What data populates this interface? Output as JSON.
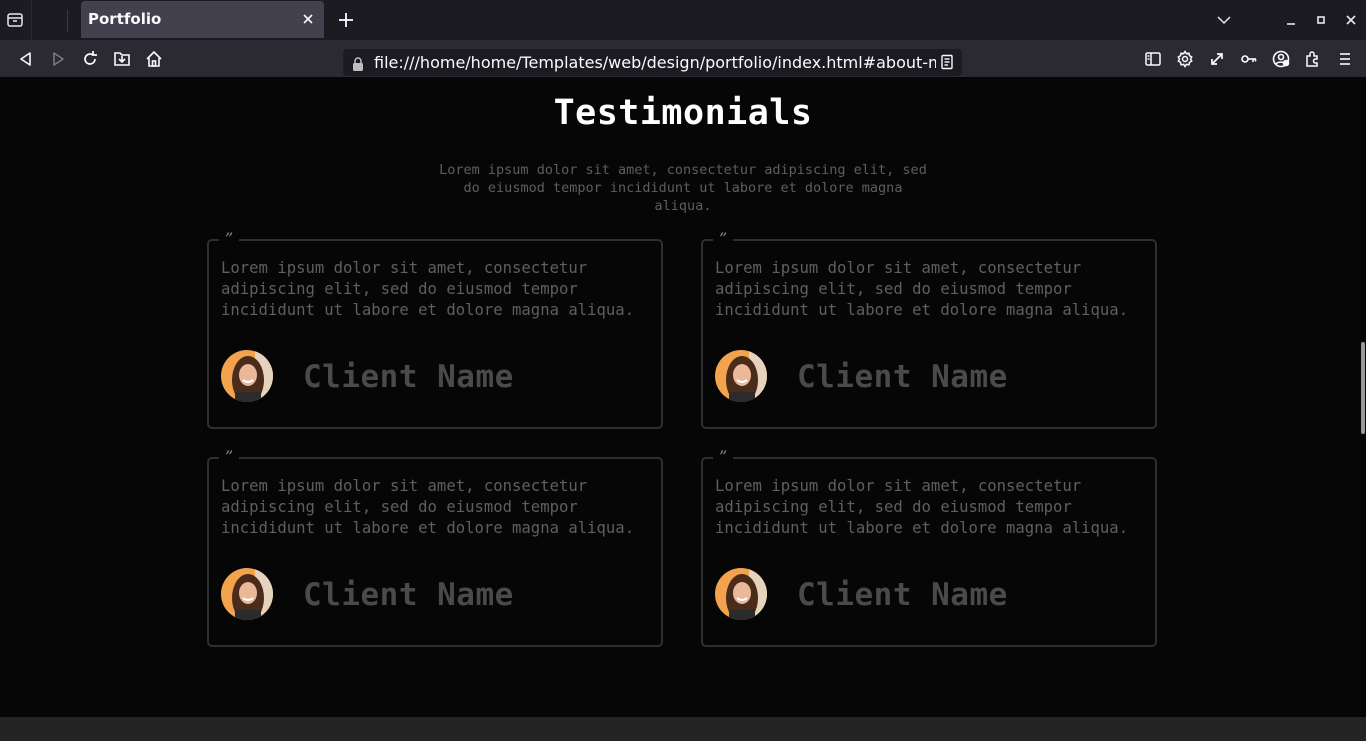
{
  "browser": {
    "tab_title": "Portfolio",
    "url": "file:///home/home/Templates/web/design/portfolio/index.html#about-me"
  },
  "testimonials": {
    "heading": "Testimonials",
    "intro": "Lorem ipsum dolor sit amet, consectetur adipiscing elit, sed do eiusmod tempor incididunt ut labore et dolore magna aliqua.",
    "cards": [
      {
        "quote_mark": "”",
        "text": "Lorem ipsum dolor sit amet, consectetur adipiscing elit, sed do eiusmod tempor incididunt ut labore et dolore magna aliqua.",
        "client_name": "Client Name"
      },
      {
        "quote_mark": "”",
        "text": "Lorem ipsum dolor sit amet, consectetur adipiscing elit, sed do eiusmod tempor incididunt ut labore et dolore magna aliqua.",
        "client_name": "Client Name"
      },
      {
        "quote_mark": "”",
        "text": "Lorem ipsum dolor sit amet, consectetur adipiscing elit, sed do eiusmod tempor incididunt ut labore et dolore magna aliqua.",
        "client_name": "Client Name"
      },
      {
        "quote_mark": "”",
        "text": "Lorem ipsum dolor sit amet, consectetur adipiscing elit, sed do eiusmod tempor incididunt ut labore et dolore magna aliqua.",
        "client_name": "Client Name"
      }
    ]
  },
  "icons": {
    "toolbar": [
      "tab-overview-icon",
      "back-icon",
      "forward-icon",
      "reload-icon",
      "save-icon",
      "home-icon",
      "lock-icon",
      "reader-view-icon",
      "sidebar-icon",
      "settings-icon",
      "fullscreen-icon",
      "key-icon",
      "account-icon",
      "extensions-icon",
      "menu-icon"
    ]
  },
  "colors": {
    "page_background": "#060606",
    "card_border": "#2f2f2f",
    "heading": "#ffffff",
    "muted_text": "#5f5f5f",
    "client_name": "#4a4a4a"
  }
}
